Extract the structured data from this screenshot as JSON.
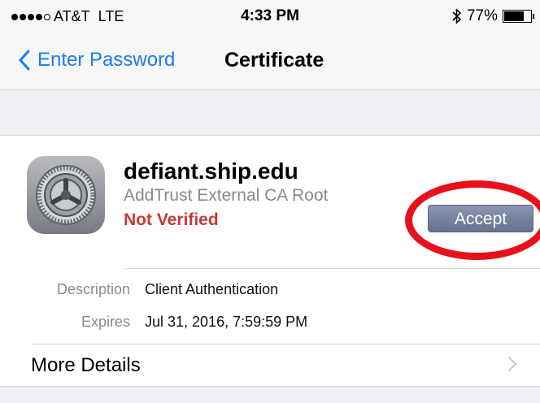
{
  "status_bar": {
    "carrier": "AT&T",
    "network": "LTE",
    "time": "4:33 PM",
    "bluetooth_icon": "bluetooth-icon",
    "battery_percent": "77%",
    "battery_level": 0.77
  },
  "nav": {
    "back_label": "Enter Password",
    "title": "Certificate"
  },
  "certificate": {
    "name": "defiant.ship.edu",
    "issuer": "AddTrust External CA Root",
    "status": "Not Verified",
    "icon": "settings-gear-icon"
  },
  "actions": {
    "accept_label": "Accept"
  },
  "details": {
    "description_label": "Description",
    "description_value": "Client Authentication",
    "expires_label": "Expires",
    "expires_value": "Jul 31, 2016, 7:59:59 PM"
  },
  "more": {
    "label": "More Details"
  },
  "colors": {
    "accent": "#1a7cf0",
    "not_verified": "#c23a3a",
    "highlight": "#e8101a"
  }
}
